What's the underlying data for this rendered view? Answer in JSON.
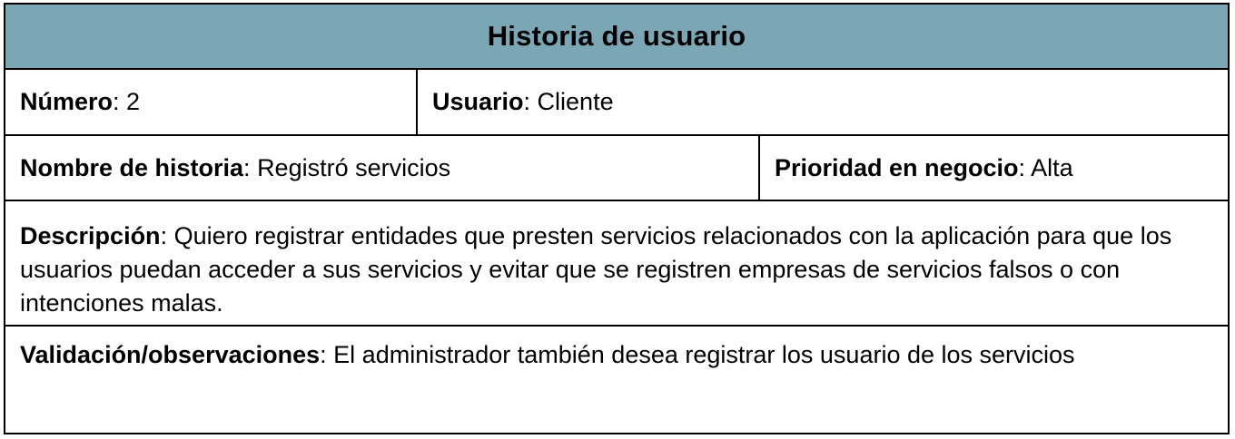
{
  "header": {
    "title": "Historia de usuario"
  },
  "fields": {
    "numero": {
      "label": "Número",
      "sep": ": ",
      "value": "2"
    },
    "usuario": {
      "label": "Usuario",
      "sep": ": ",
      "value": "Cliente"
    },
    "nombre": {
      "label": "Nombre de historia",
      "sep": ": ",
      "value": "Registró servicios"
    },
    "prioridad": {
      "label": "Prioridad en negocio",
      "sep": ": ",
      "value": "Alta"
    },
    "descripcion": {
      "label": "Descripción",
      "sep": ": ",
      "value": "Quiero registrar entidades que presten servicios relacionados con la aplicación para que los usuarios puedan acceder a sus servicios y evitar que se registren empresas de servicios falsos o con intenciones malas."
    },
    "validacion": {
      "label": "Validación/observaciones",
      "sep": ": ",
      "value": "El administrador también desea registrar los usuario de los servicios"
    }
  },
  "colors": {
    "header_bg": "#7ba6b4",
    "border": "#000000",
    "text": "#000000"
  }
}
